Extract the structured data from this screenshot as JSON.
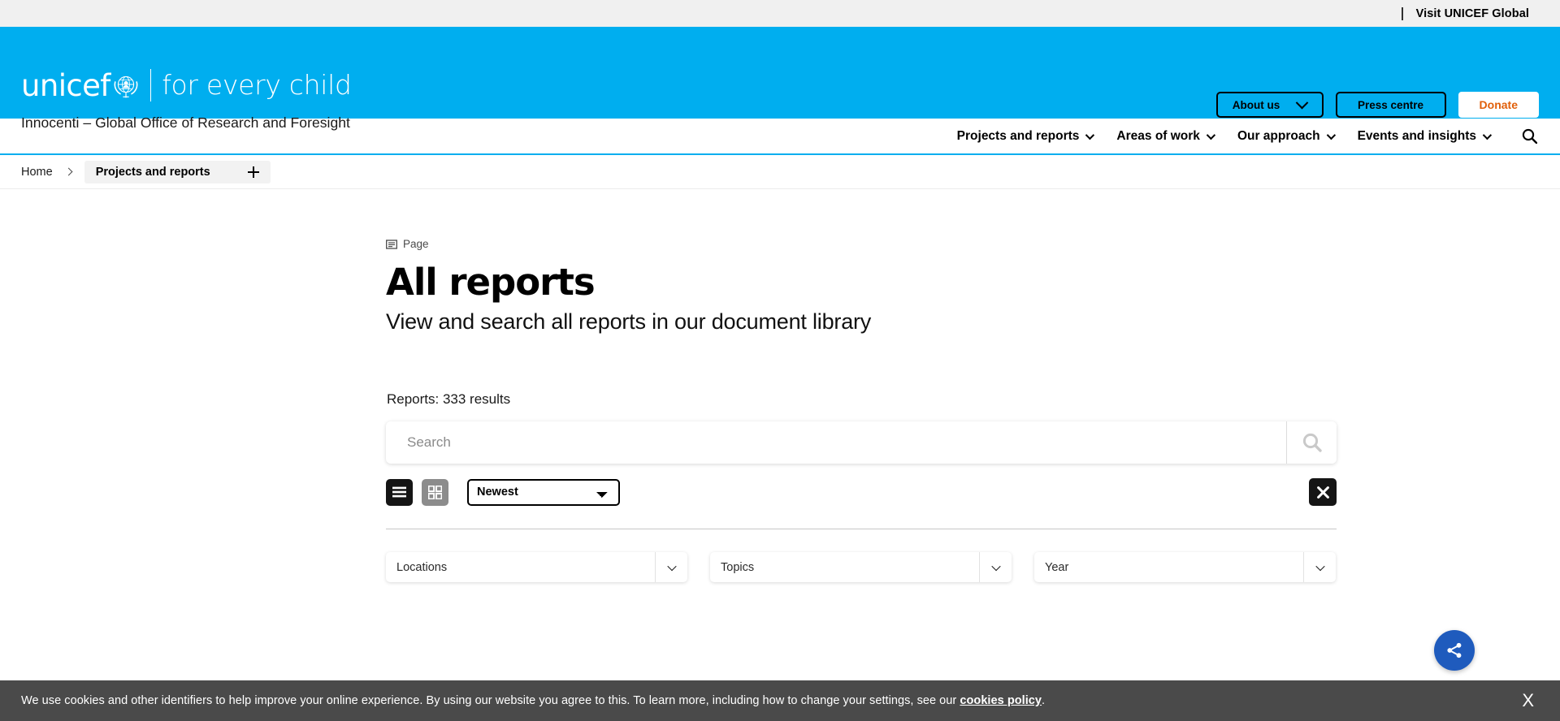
{
  "utility_bar": {
    "visit_global_label": "Visit UNICEF Global"
  },
  "brand": {
    "logo_word": "unicef",
    "logo_emblem": "unicef-emblem-icon",
    "tagline": "for every child",
    "subtitle": "Innocenti – Global Office of Research and Foresight",
    "about_us_label": "About us",
    "press_centre_label": "Press centre",
    "donate_label": "Donate",
    "accent_blue": "#00aeef",
    "donate_text_color": "#e1600b"
  },
  "main_nav": {
    "items": [
      {
        "label": "Projects and reports",
        "has_caret": true
      },
      {
        "label": "Areas of work",
        "has_caret": true
      },
      {
        "label": "Our approach",
        "has_caret": true
      },
      {
        "label": "Events and insights",
        "has_caret": true
      }
    ],
    "search_icon": "search-icon"
  },
  "breadcrumb": {
    "home_label": "Home",
    "current_label": "Projects and reports",
    "expand_icon": "plus-icon"
  },
  "page": {
    "kicker_icon": "page-icon",
    "kicker_label": "Page",
    "title": "All reports",
    "subtitle": "View and search all reports in our document library"
  },
  "search": {
    "results_count_label": "Reports: 333 results",
    "placeholder": "Search",
    "value": "",
    "submit_icon": "search-icon"
  },
  "controls": {
    "list_view_icon": "list-view-icon",
    "grid_view_icon": "grid-view-icon",
    "active_view": "list",
    "sort_selected": "Newest",
    "sort_options": [
      "Newest"
    ],
    "clear_icon": "close-icon"
  },
  "filters": [
    {
      "label": "Locations",
      "caret_icon": "chevron-down-icon"
    },
    {
      "label": "Topics",
      "caret_icon": "chevron-down-icon"
    },
    {
      "label": "Year",
      "caret_icon": "chevron-down-icon"
    }
  ],
  "share": {
    "icon": "share-icon",
    "color": "#1f5bbd"
  },
  "cookie_banner": {
    "text_before": "We use cookies and other identifiers to help improve your online experience. By using our website you agree to this. To learn more, including how to change your settings, see our",
    "link_label": "cookies policy",
    "text_after": ".",
    "close_label": "X"
  }
}
